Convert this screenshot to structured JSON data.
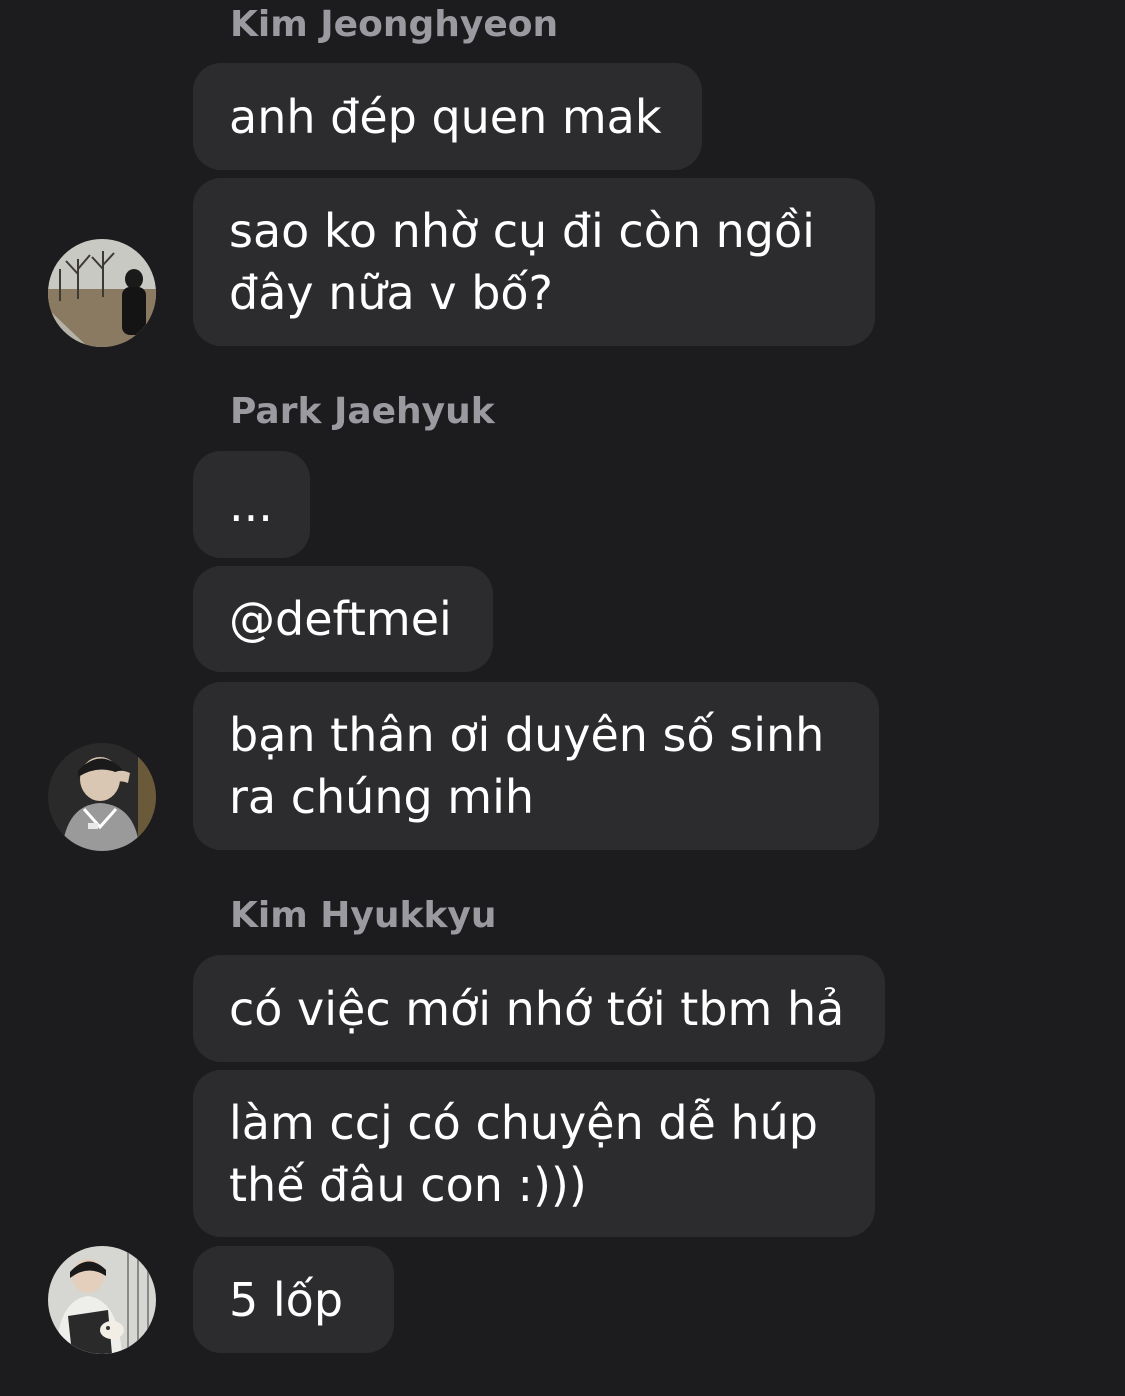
{
  "groups": [
    {
      "sender": "Kim Jeonghyeon",
      "messages": [
        "anh đép quen mak",
        "sao ko nhờ cụ đi còn ngồi đây nữa v bố?"
      ],
      "avatar_icon": "park-walkway-avatar"
    },
    {
      "sender": "Park Jaehyuk",
      "messages": [
        "...",
        "@deftmei",
        "bạn thân ơi duyên số sinh ra chúng mih"
      ],
      "avatar_icon": "jersey-person-avatar"
    },
    {
      "sender": "Kim Hyukkyu",
      "messages": [
        "có việc mới nhớ tới tbm hả",
        "làm ccj có chuyện dễ húp thế đâu con :)))",
        "5 lốp"
      ],
      "avatar_icon": "person-with-pet-avatar"
    }
  ],
  "colors": {
    "background": "#1c1c1e",
    "bubble": "#2c2c2e",
    "sender_name": "#9a9aa0",
    "message_text": "#ffffff"
  }
}
